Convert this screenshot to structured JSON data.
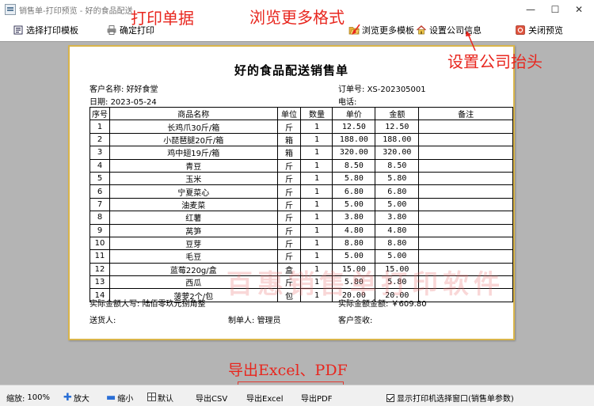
{
  "window": {
    "title": "销售单-打印预览 - 好的食品配送",
    "minimize": "—",
    "maximize": "☐",
    "close": "✕"
  },
  "toolbar": {
    "select_template": "选择打印模板",
    "confirm_print": "确定打印",
    "browse_templates": "浏览更多模板",
    "company_info": "设置公司信息",
    "close_preview": "关闭预览"
  },
  "document": {
    "title": "好的食品配送销售单",
    "customer_label": "客户名称:",
    "customer": "好好食堂",
    "date_label": "日期:",
    "date": "2023-05-24",
    "order_no_label": "订单号:",
    "order_no": "XS-202305001",
    "phone_label": "电话:",
    "columns": [
      "序号",
      "商品名称",
      "单位",
      "数量",
      "单价",
      "金额",
      "备注"
    ],
    "rows": [
      [
        "1",
        "长鸡爪30斤/箱",
        "斤",
        "1",
        "12.50",
        "12.50",
        ""
      ],
      [
        "2",
        "小琵琶腿20斤/箱",
        "箱",
        "1",
        "188.00",
        "188.00",
        ""
      ],
      [
        "3",
        "鸡中翅19斤/箱",
        "箱",
        "1",
        "320.00",
        "320.00",
        ""
      ],
      [
        "4",
        "青豆",
        "斤",
        "1",
        "8.50",
        "8.50",
        ""
      ],
      [
        "5",
        "玉米",
        "斤",
        "1",
        "5.80",
        "5.80",
        ""
      ],
      [
        "6",
        "宁夏菜心",
        "斤",
        "1",
        "6.80",
        "6.80",
        ""
      ],
      [
        "7",
        "油麦菜",
        "斤",
        "1",
        "5.00",
        "5.00",
        ""
      ],
      [
        "8",
        "红薯",
        "斤",
        "1",
        "3.80",
        "3.80",
        ""
      ],
      [
        "9",
        "莴笋",
        "斤",
        "1",
        "4.80",
        "4.80",
        ""
      ],
      [
        "10",
        "豆芽",
        "斤",
        "1",
        "8.80",
        "8.80",
        ""
      ],
      [
        "11",
        "毛豆",
        "斤",
        "1",
        "5.00",
        "5.00",
        ""
      ],
      [
        "12",
        "蓝莓220g/盒",
        "盒",
        "1",
        "15.00",
        "15.00",
        ""
      ],
      [
        "13",
        "西瓜",
        "斤",
        "1",
        "5.80",
        "5.80",
        ""
      ],
      [
        "14",
        "菠萝2个/包",
        "包",
        "1",
        "20.00",
        "20.00",
        ""
      ]
    ],
    "amount_words_label": "实际金额大写:",
    "amount_words": "陆佰零玖元捌角整",
    "amount_label": "实际金额金额:",
    "amount": "￥609.80",
    "shipper_label": "送货人:",
    "maker_label": "制单人:",
    "maker": "管理员",
    "customer_sign_label": "客户签收:"
  },
  "watermark": "百惠销售单打印软件",
  "annotations": {
    "print_doc": "打印单据",
    "browse_formats": "浏览更多格式",
    "company_header": "设置公司抬头",
    "export": "导出Excel、PDF"
  },
  "statusbar": {
    "zoom_label": "缩放:",
    "zoom_value": "100%",
    "zoom_in": "放大",
    "zoom_out": "缩小",
    "default": "默认",
    "export_csv": "导出CSV",
    "export_excel": "导出Excel",
    "export_pdf": "导出PDF",
    "show_printer_dialog": "显示打印机选择窗口(销售单参数)"
  },
  "colors": {
    "annotation": "#e8261e",
    "paper_border": "#d9b54a",
    "preview_bg": "#b4b4b4"
  }
}
